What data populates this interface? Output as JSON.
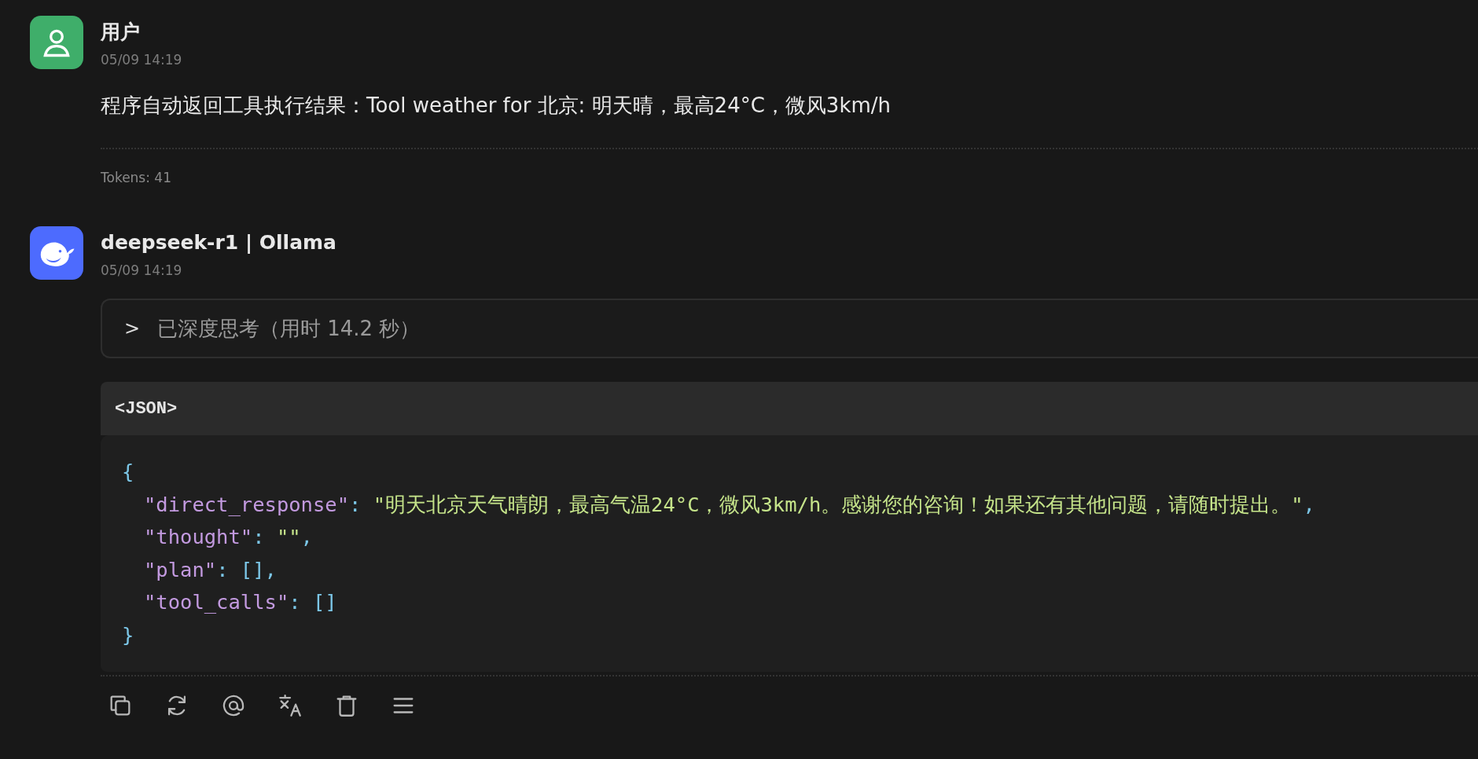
{
  "messages": [
    {
      "kind": "user",
      "name": "用户",
      "time": "05/09 14:19",
      "text": "程序自动返回工具执行结果：Tool weather for 北京: 明天晴，最高24°C，微风3km/h",
      "tokens": "Tokens: 41"
    },
    {
      "kind": "assistant",
      "name": "deepseek-r1 | Ollama",
      "time": "05/09 14:19",
      "thinking": {
        "expanded": false,
        "toggle": ">",
        "label": "已深度思考（用时 14.2 秒）"
      },
      "code": {
        "language": "<JSON>",
        "lines": [
          {
            "indented": false,
            "segments": [
              {
                "kind": "punct",
                "text": "{"
              }
            ]
          },
          {
            "indented": true,
            "segments": [
              {
                "kind": "key",
                "text": "\"direct_response\""
              },
              {
                "kind": "punct",
                "text": ": "
              },
              {
                "kind": "string",
                "text": "\"明天北京天气晴朗，最高气温24°C，微风3km/h。感谢您的咨询！如果还有其他问题，请随时提出。\""
              },
              {
                "kind": "punct",
                "text": ","
              }
            ]
          },
          {
            "indented": true,
            "segments": [
              {
                "kind": "key",
                "text": "\"thought\""
              },
              {
                "kind": "punct",
                "text": ": "
              },
              {
                "kind": "string",
                "text": "\"\""
              },
              {
                "kind": "punct",
                "text": ","
              }
            ]
          },
          {
            "indented": true,
            "segments": [
              {
                "kind": "key",
                "text": "\"plan\""
              },
              {
                "kind": "punct",
                "text": ": [],"
              }
            ]
          },
          {
            "indented": true,
            "segments": [
              {
                "kind": "key",
                "text": "\"tool_calls\""
              },
              {
                "kind": "punct",
                "text": ": []"
              }
            ]
          },
          {
            "indented": false,
            "segments": [
              {
                "kind": "punct",
                "text": "}"
              }
            ]
          }
        ]
      },
      "actions": [
        {
          "kind": "copy"
        },
        {
          "kind": "regenerate"
        },
        {
          "kind": "mention"
        },
        {
          "kind": "translate"
        },
        {
          "kind": "delete"
        },
        {
          "kind": "more"
        }
      ]
    }
  ]
}
